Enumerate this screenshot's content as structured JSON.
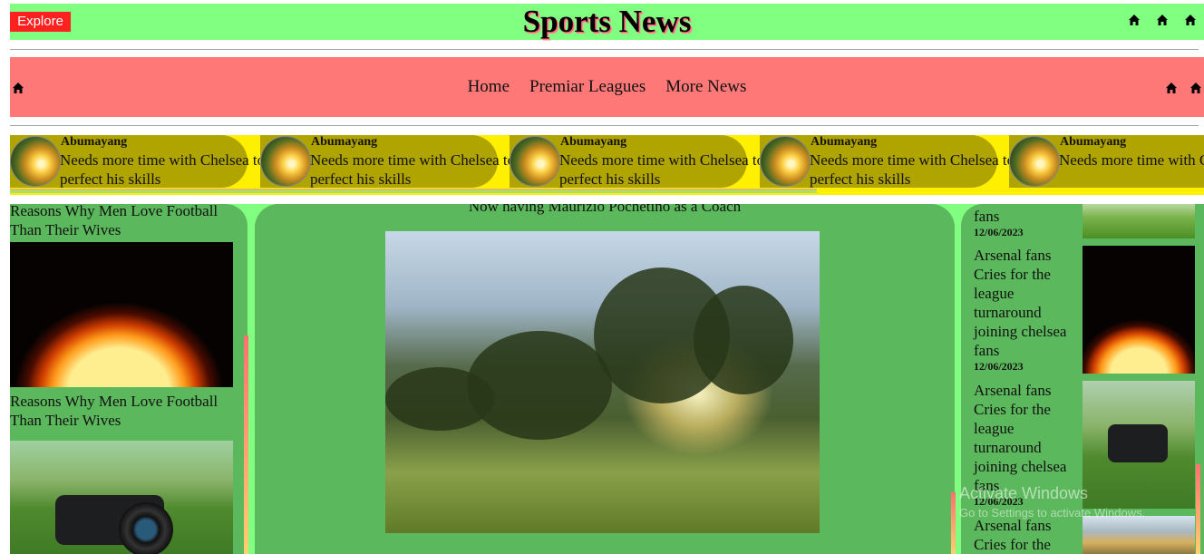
{
  "header": {
    "explore_label": "Explore",
    "title": "Sports News",
    "icons": [
      "home-icon",
      "home-icon",
      "home-icon"
    ]
  },
  "nav": {
    "links": [
      "Home",
      "Premiar Leagues",
      "More News"
    ],
    "left_icon": "home-icon",
    "right_icons": [
      "home-icon",
      "home-icon"
    ]
  },
  "ticker": {
    "items": [
      {
        "name": "Abumayang",
        "text": "Needs more time with Chelsea to perfect his skills"
      },
      {
        "name": "Abumayang",
        "text": "Needs more time with Chelsea to perfect his skills"
      },
      {
        "name": "Abumayang",
        "text": "Needs more time with Chelsea to perfect his skills"
      },
      {
        "name": "Abumayang",
        "text": "Needs more time with Chelsea to perfect his skills"
      },
      {
        "name": "Abumayang",
        "text": "Needs more time with Chelsea to perfect his"
      }
    ]
  },
  "left": {
    "articles": [
      {
        "headline": "Reasons Why Men Love Football Than Their Wives"
      },
      {
        "headline": "Reasons Why Men Love Football Than Their Wives"
      }
    ]
  },
  "center": {
    "caption": "Now having Maurizio Pochetino as a Coach"
  },
  "right": {
    "articles": [
      {
        "headline": "fans",
        "date": "12/06/2023"
      },
      {
        "headline": "Arsenal fans Cries for the league turnaround joining chelsea fans",
        "date": "12/06/2023"
      },
      {
        "headline": "Arsenal fans Cries for the league turnaround joining chelsea fans",
        "date": "12/06/2023"
      },
      {
        "headline": "Arsenal fans Cries for the",
        "date": ""
      }
    ]
  },
  "overlay": {
    "watermark": "Activate Windows",
    "watermark_sub": "Go to Settings to activate Windows."
  }
}
